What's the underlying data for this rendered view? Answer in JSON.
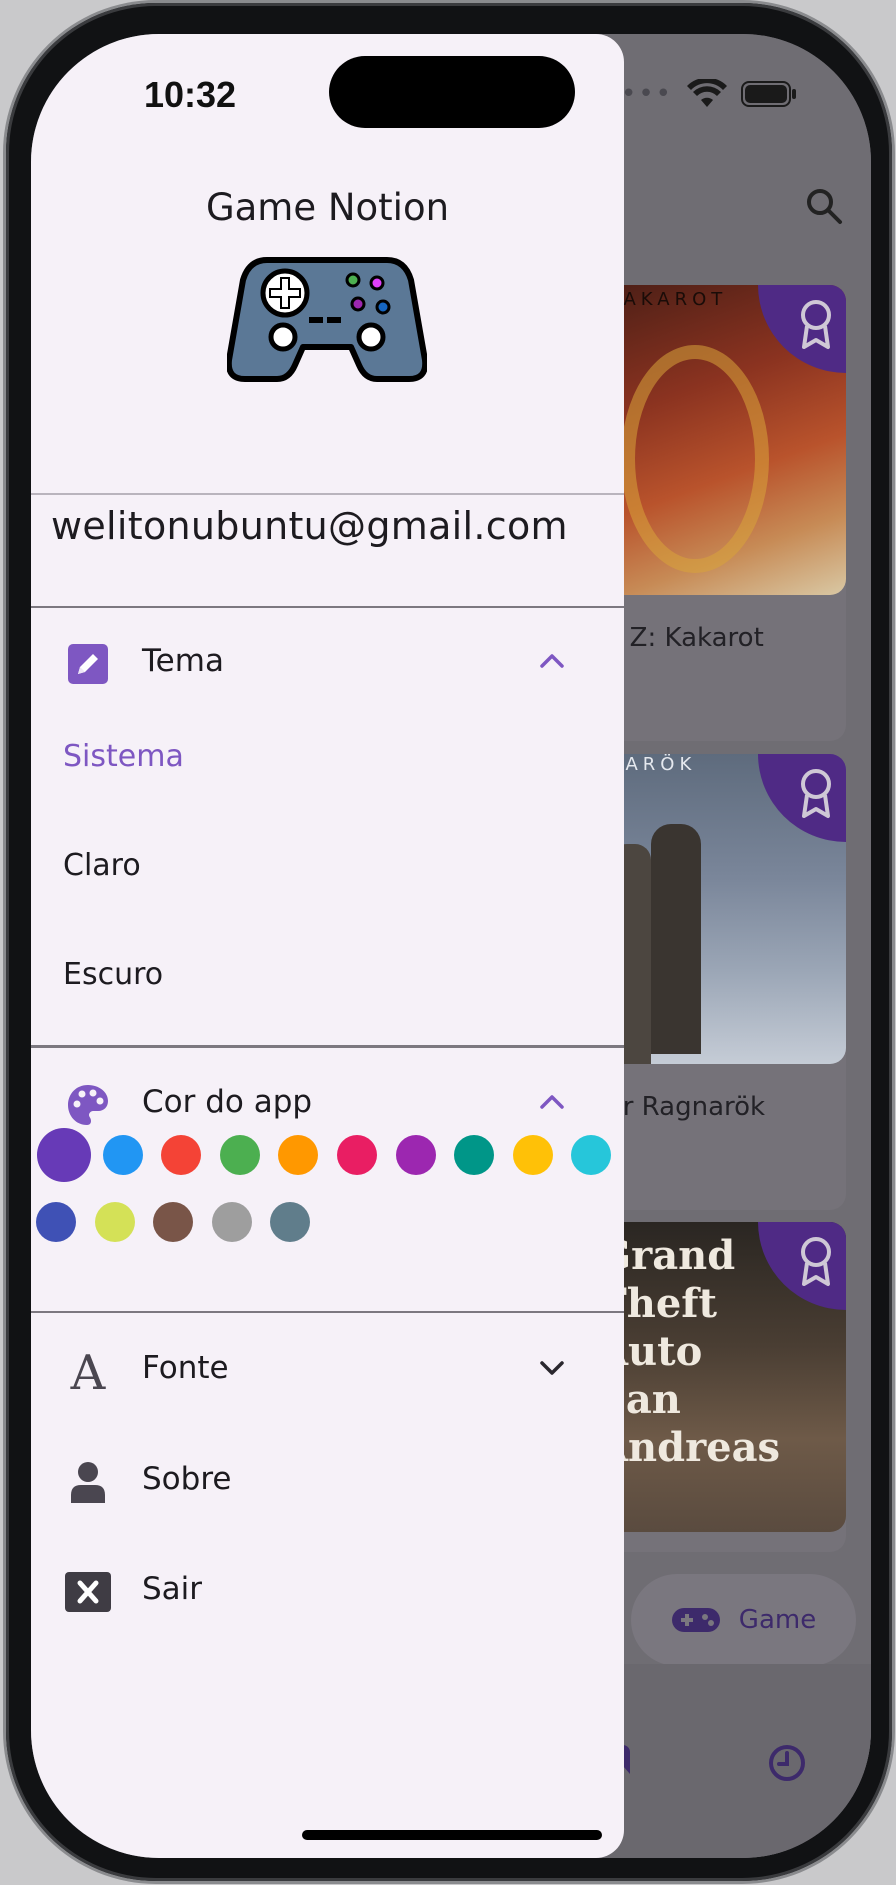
{
  "status_bar": {
    "time": "10:32"
  },
  "drawer": {
    "title": "Game Notion",
    "email": "welitonubuntu@gmail.com",
    "theme_section": {
      "label": "Tema",
      "icon": "edit-icon",
      "expanded": true,
      "options": [
        {
          "label": "Sistema",
          "selected": true
        },
        {
          "label": "Claro",
          "selected": false
        },
        {
          "label": "Escuro",
          "selected": false
        }
      ]
    },
    "color_section": {
      "label": "Cor do app",
      "icon": "palette-icon",
      "expanded": true,
      "selected_color": "#673ab7",
      "colors": [
        "#673ab7",
        "#2196f3",
        "#f44336",
        "#4caf50",
        "#ff9800",
        "#e91e63",
        "#9c27b0",
        "#009688",
        "#ffc107",
        "#26c6da",
        "#3f51b5",
        "#d4e157",
        "#795548",
        "#9e9e9e",
        "#607d8b"
      ]
    },
    "font_section": {
      "label": "Fonte",
      "icon": "font-icon",
      "expanded": false
    },
    "about": {
      "label": "Sobre",
      "icon": "person-icon"
    },
    "logout": {
      "label": "Sair",
      "icon": "close-box-icon"
    }
  },
  "background": {
    "cards": [
      {
        "title": "all Z: Kakarot",
        "art_text": "KAKAROT"
      },
      {
        "title": "Var Ragnarök",
        "art_text": "NARÖK"
      },
      {
        "title": "",
        "art_text": "Grand Theft Auto San Andreas"
      }
    ],
    "game_button": {
      "label": "Game"
    }
  },
  "colors": {
    "accent": "#7e57c2",
    "drawer_bg": "#f6f1f8",
    "text": "#1d1b20"
  }
}
